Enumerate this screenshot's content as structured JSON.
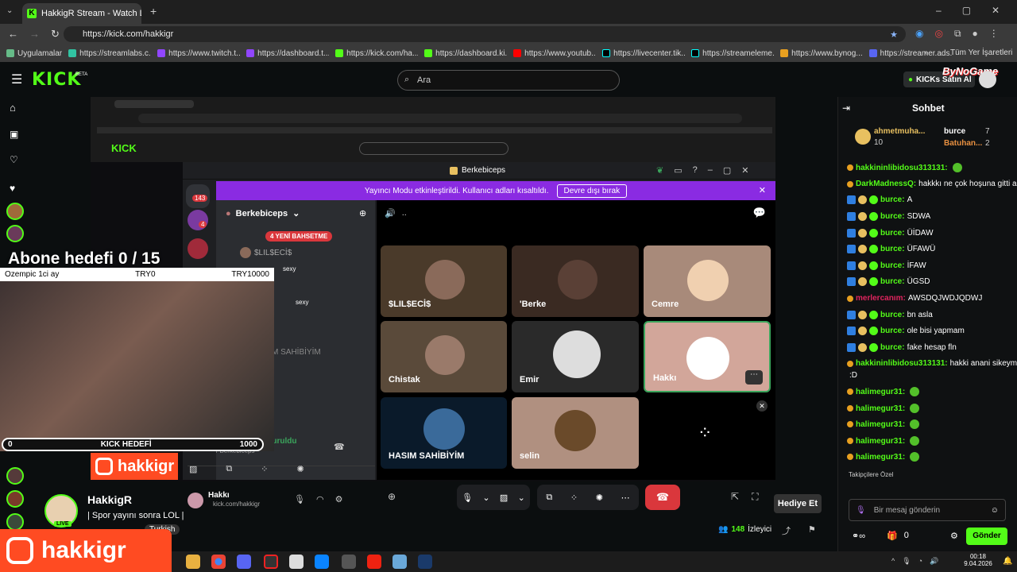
{
  "browser": {
    "tab_title": "HakkigR Stream - Watch Live o",
    "url": "https://kick.com/hakkigr",
    "bookmarks": [
      "Uygulamalar",
      "https://streamlabs.c...",
      "https://www.twitch.t...",
      "https://dashboard.t...",
      "https://kick.com/ha...",
      "https://dashboard.ki...",
      "https://www.youtub...",
      "https://livecenter.tik...",
      "https://streameleme...",
      "https://www.bynog...",
      "https://streamer.ads..."
    ],
    "all_bookmarks": "Tüm Yer İşaretleri"
  },
  "kick": {
    "logo": "KICK",
    "beta": "BETA",
    "search_placeholder": "Ara",
    "kicks_button": "KICKs Satın Al",
    "bynogame": "ByNoGame",
    "gift_button": "Hediye Et",
    "viewers": "148",
    "viewers_label": "İzleyici"
  },
  "channel": {
    "name": "HakkigR",
    "title": "| Spor yayını sonra LOL |",
    "category": "Turkish",
    "live": "LIVE"
  },
  "overlay": {
    "sub_goal": "Abone hedefi 0 / 15",
    "ozempic_left": "Ozempic 1ci ay",
    "ozempic_mid": "TRY0",
    "ozempic_right": "TRY10000",
    "kick_goal_label": "KICK HEDEFİ",
    "kick_goal_start": "0",
    "kick_goal_end": "1000",
    "social_handle": "hakkigr",
    "social_handle_big": "hakkigr"
  },
  "discord": {
    "title": "Berkebiceps",
    "banner_text": "Yayıncı Modu etkinleştirildi. Kullanıcı adları kısaltıldı.",
    "banner_button": "Devre dışı bırak",
    "server_name": "Berkebiceps",
    "new_mentions": "4 YENİ BAHSETME",
    "channel_row": "$LIL$ECİ$",
    "tag1": "sexy",
    "tag2": "sexy",
    "connection": "Ses Bağlantısı Kuruldu",
    "connection_sub": "/ Berkebiceps",
    "user": "Hakkı",
    "user_sub": "kick.com/hakkigr",
    "vc_name": "..",
    "badge_count1": "143",
    "badge_count2": "4",
    "ghost_text": "M SAHİBİYİM",
    "participants": [
      "$LIL$ECİ$",
      "'Berke",
      "Cemre",
      "Chistak",
      "Emir",
      "Hakkı",
      "HASIM SAHİBİYİM",
      "selin"
    ]
  },
  "chat": {
    "title": "Sohbet",
    "top1_name": "ahmetmuha...",
    "top1_val": "10",
    "top2_name": "burce",
    "top2_val": "7",
    "top3_name": "Batuhan...",
    "top3_val": "2",
    "messages": [
      {
        "user": "hakkininlibidosu313131:",
        "text": "",
        "color": "#53fc18"
      },
      {
        "user": "DarkMadnessQ:",
        "text": "hakkkı ne çok hoşuna gitti amk",
        "color": "#53fc18"
      },
      {
        "user": "burce:",
        "text": "A",
        "color": "#53fc18"
      },
      {
        "user": "burce:",
        "text": "SDWA",
        "color": "#53fc18"
      },
      {
        "user": "burce:",
        "text": "ÜİDAW",
        "color": "#53fc18"
      },
      {
        "user": "burce:",
        "text": "ÜFAWÜ",
        "color": "#53fc18"
      },
      {
        "user": "burce:",
        "text": "İFAW",
        "color": "#53fc18"
      },
      {
        "user": "burce:",
        "text": "ÜGSD",
        "color": "#53fc18"
      },
      {
        "user": "merlercanım:",
        "text": "AWSDQJWDJQDWJ",
        "color": "#e0245e"
      },
      {
        "user": "burce:",
        "text": "bn asla",
        "color": "#53fc18"
      },
      {
        "user": "burce:",
        "text": "ole bisi yapmam",
        "color": "#53fc18"
      },
      {
        "user": "burce:",
        "text": "fake hesap fln",
        "color": "#53fc18"
      },
      {
        "user": "hakkininlibidosu313131:",
        "text": "hakki anani sikeym",
        "color": "#53fc18"
      },
      {
        "user": "",
        "text": ":D",
        "color": "#53fc18"
      },
      {
        "user": "halimegur31:",
        "text": "",
        "color": "#53fc18"
      },
      {
        "user": "halimegur31:",
        "text": "",
        "color": "#53fc18"
      },
      {
        "user": "halimegur31:",
        "text": "",
        "color": "#53fc18"
      },
      {
        "user": "halimegur31:",
        "text": "",
        "color": "#53fc18"
      },
      {
        "user": "halimegur31:",
        "text": "",
        "color": "#53fc18"
      }
    ],
    "followers_label": "Takipçilere Özel",
    "input_placeholder": "Bir mesaj gönderin",
    "kicks_count": "0",
    "send": "Gönder"
  },
  "taskbar": {
    "time": "00:18",
    "date": "9.04.2026"
  },
  "colors": {
    "kick_green": "#53fc18",
    "discord_purple": "#8a2be2",
    "orange": "#ff4b22",
    "end_call": "#da373c"
  }
}
